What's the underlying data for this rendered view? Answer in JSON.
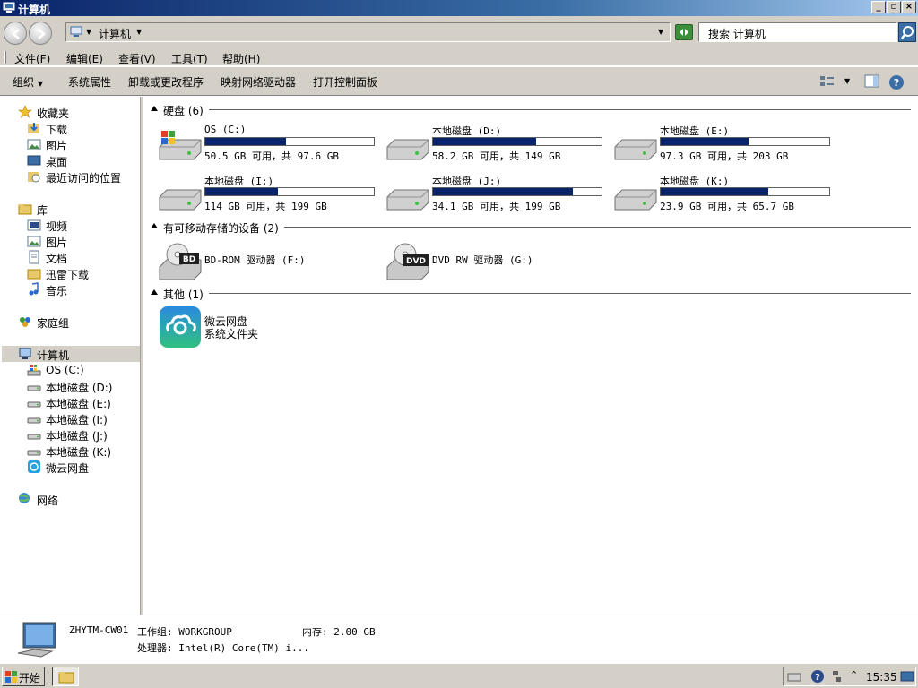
{
  "window": {
    "title": "计算机"
  },
  "address": {
    "crumb": "计算机",
    "search_placeholder": "搜索 计算机"
  },
  "menu": [
    {
      "label": "文件(F)"
    },
    {
      "label": "编辑(E)"
    },
    {
      "label": "查看(V)"
    },
    {
      "label": "工具(T)"
    },
    {
      "label": "帮助(H)"
    }
  ],
  "toolbar": {
    "organize": "组织",
    "system_properties": "系统属性",
    "uninstall": "卸载或更改程序",
    "map_drive": "映射网络驱动器",
    "control_panel": "打开控制面板"
  },
  "nav": {
    "favorites": "收藏夹",
    "downloads": "下载",
    "pictures": "图片",
    "desktop": "桌面",
    "recent": "最近访问的位置",
    "libraries": "库",
    "videos": "视频",
    "lib_pictures": "图片",
    "documents": "文档",
    "xunlei": "迅雷下载",
    "music": "音乐",
    "homegroup": "家庭组",
    "computer": "计算机",
    "drive_c": "OS (C:)",
    "drive_d": "本地磁盘 (D:)",
    "drive_e": "本地磁盘 (E:)",
    "drive_i": "本地磁盘 (I:)",
    "drive_j": "本地磁盘 (J:)",
    "drive_k": "本地磁盘 (K:)",
    "weiyun": "微云网盘",
    "network": "网络"
  },
  "groups": {
    "hard_disks": "硬盘 (6)",
    "removable": "有可移动存储的设备 (2)",
    "other": "其他 (1)"
  },
  "drives": [
    {
      "name": "OS (C:)",
      "free": "50.5 GB 可用，共 97.6 GB",
      "used_fraction": 0.48
    },
    {
      "name": "本地磁盘 (D:)",
      "free": "58.2 GB 可用，共 149 GB",
      "used_fraction": 0.61
    },
    {
      "name": "本地磁盘 (E:)",
      "free": "97.3 GB 可用，共 203 GB",
      "used_fraction": 0.52
    },
    {
      "name": "本地磁盘 (I:)",
      "free": "114 GB 可用，共 199 GB",
      "used_fraction": 0.43
    },
    {
      "name": "本地磁盘 (J:)",
      "free": "34.1 GB 可用，共 199 GB",
      "used_fraction": 0.83
    },
    {
      "name": "本地磁盘 (K:)",
      "free": "23.9 GB 可用，共 65.7 GB",
      "used_fraction": 0.64
    }
  ],
  "removable": [
    {
      "name": "BD-ROM 驱动器 (F:)",
      "badge": "BD"
    },
    {
      "name": "DVD RW 驱动器 (G:)",
      "badge": "DVD"
    }
  ],
  "other": {
    "name": "微云网盘",
    "type": "系统文件夹"
  },
  "details": {
    "computer_name": "ZHYTM-CW01",
    "workgroup": "工作组: WORKGROUP",
    "memory": "内存: 2.00 GB",
    "processor": "处理器: Intel(R) Core(TM) i..."
  },
  "taskbar": {
    "start": "开始",
    "clock": "15:35"
  },
  "colors": {
    "bar_fill": "#0a246a",
    "title_bar": "#0a246a"
  }
}
